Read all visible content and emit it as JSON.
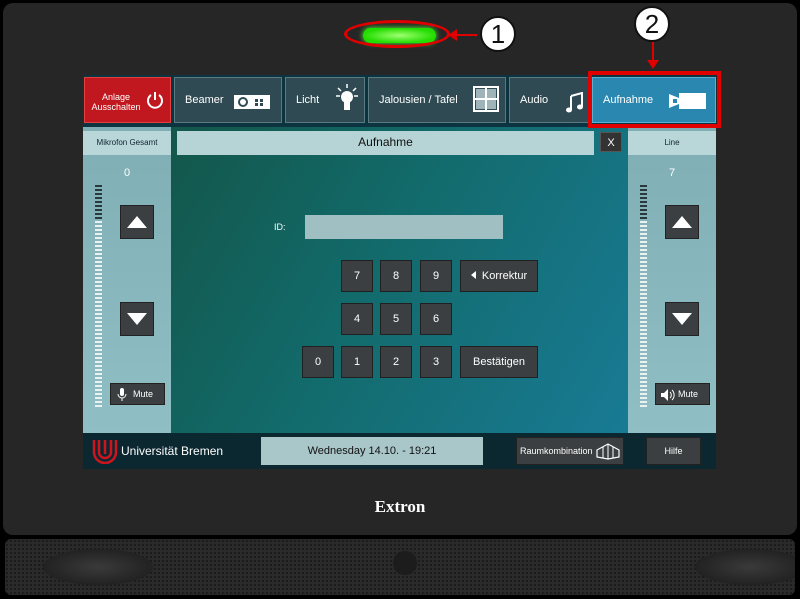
{
  "annotations": {
    "marker1": "1",
    "marker2": "2"
  },
  "brand": "Extron",
  "tabs": [
    {
      "label": "Anlage Ausschalten",
      "icon": "power-icon"
    },
    {
      "label": "Beamer",
      "icon": "projector-icon"
    },
    {
      "label": "Licht",
      "icon": "lightbulb-icon"
    },
    {
      "label": "Jalousien / Tafel",
      "icon": "window-blinds-icon"
    },
    {
      "label": "Audio",
      "icon": "music-note-icon"
    },
    {
      "label": "Aufnahme",
      "icon": "camera-icon",
      "active": true
    }
  ],
  "left_panel": {
    "title": "Mikrofon Gesamt",
    "value": "0",
    "mute_label": "Mute"
  },
  "right_panel": {
    "title": "Line",
    "value": "7",
    "mute_label": "Mute"
  },
  "dialog": {
    "title": "Aufnahme",
    "close_label": "X",
    "id_label": "ID:",
    "id_value": "",
    "keys_row1": [
      "7",
      "8",
      "9"
    ],
    "keys_row2": [
      "4",
      "5",
      "6"
    ],
    "keys_row3": [
      "0",
      "1",
      "2",
      "3"
    ],
    "correction_label": "Korrektur",
    "confirm_label": "Bestätigen"
  },
  "footer": {
    "logo_text": "Universität Bremen",
    "datetime": "Wednesday 14.10. - 19:21",
    "room_label": "Raumkombination",
    "help_label": "Hilfe"
  },
  "colors": {
    "led": "#22dd00",
    "annotation": "#e00000",
    "power_tab": "#c0181e",
    "active_tab": "#2a88b0"
  }
}
